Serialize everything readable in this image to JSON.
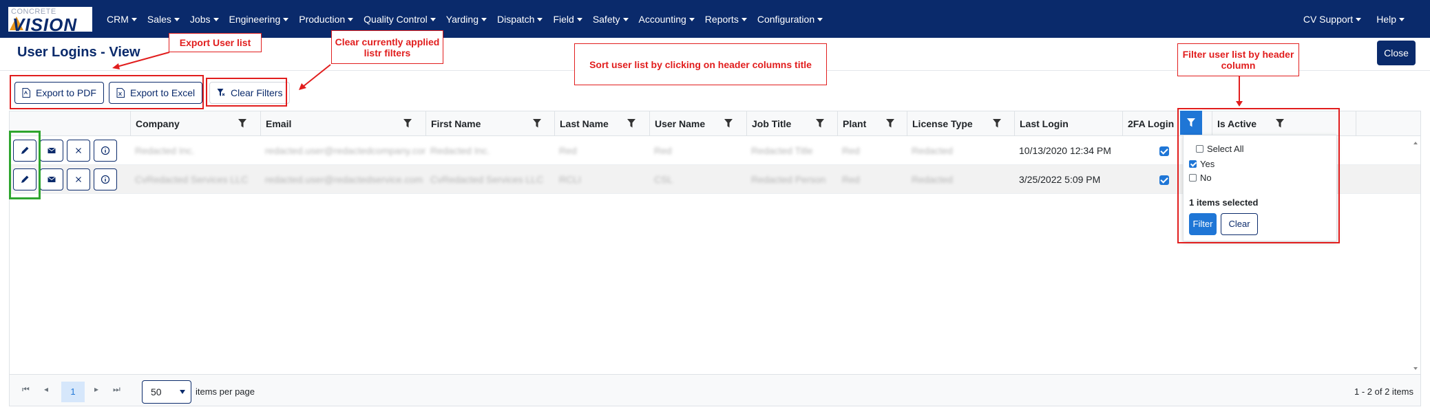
{
  "app": {
    "logo_top": "CONCRETE",
    "logo_main": "VISION"
  },
  "nav": {
    "items": [
      "CRM",
      "Sales",
      "Jobs",
      "Engineering",
      "Production",
      "Quality Control",
      "Yarding",
      "Dispatch",
      "Field",
      "Safety",
      "Accounting",
      "Reports",
      "Configuration"
    ],
    "right": [
      "CV Support",
      "Help"
    ]
  },
  "page": {
    "title": "User Logins - View",
    "close_label": "Close"
  },
  "toolbar": {
    "export_pdf": "Export to PDF",
    "export_excel": "Export to Excel",
    "clear_filters": "Clear Filters"
  },
  "grid": {
    "columns": [
      "Company",
      "Email",
      "First Name",
      "Last Name",
      "User Name",
      "Job Title",
      "Plant",
      "License Type",
      "Last Login",
      "2FA Login",
      "Is Active"
    ],
    "rows": [
      {
        "company": "Redacted Inc.",
        "email": "redacted.user@redactedcompany.com",
        "first_name": "Redacted Inc.",
        "last_name": "Red",
        "user_name": "Red",
        "job_title": "Redacted Title",
        "plant": "Red",
        "license_type": "Redacted",
        "last_login": "10/13/2020 12:34 PM",
        "twofa": true
      },
      {
        "company": "CvRedacted Services LLC",
        "email": "redacted.user@redactedservice.com",
        "first_name": "CvRedacted Services LLC",
        "last_name": "RCLI",
        "user_name": "CSL",
        "job_title": "Redacted Person",
        "plant": "Red",
        "license_type": "Redacted",
        "last_login": "3/25/2022 5:09 PM",
        "twofa": true
      }
    ]
  },
  "filter_popup": {
    "select_all": "Select All",
    "yes": "Yes",
    "no": "No",
    "selected_yes": true,
    "selected_no": false,
    "count_text": "1 items selected",
    "filter_label": "Filter",
    "clear_label": "Clear"
  },
  "pager": {
    "current_page": "1",
    "page_size": "50",
    "items_per_page": "items per page",
    "info": "1 - 2 of 2 items"
  },
  "annotations": {
    "export": "Export User list",
    "clear": "Clear currently applied listr filters",
    "sort": "Sort user list by clicking on header columns title",
    "filter": "Filter user list by header column"
  },
  "colors": {
    "nav_bg": "#0a2a6b",
    "accent": "#1f76d6",
    "annotation": "#e11d1d",
    "highlight": "#2ea52e"
  }
}
